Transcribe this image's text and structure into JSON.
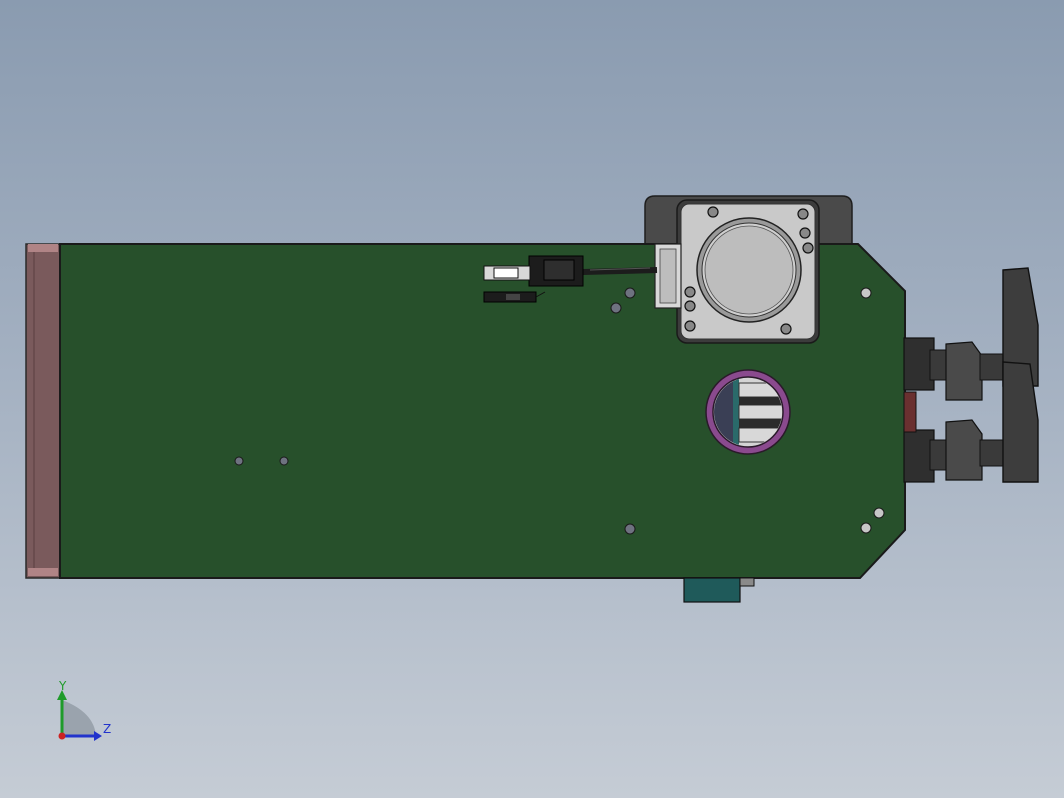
{
  "viewport": {
    "background_top": "#8a9bb0",
    "background_bottom": "#c5ccd5"
  },
  "model": {
    "plate_color": "#27502b",
    "plate_edge_color": "#1a1a1a",
    "end_block_color": "#7a5a5c",
    "motor_bracket_color": "#4a4a4a",
    "motor_face_color": "#c9c9c9",
    "motor_hub_color": "#bfbfbf",
    "ring_color": "#8a4a8e",
    "knob_color": "#3a3a3a",
    "teal_block_color": "#1f5a5a",
    "connector_color": "#1c1c1c"
  },
  "triad": {
    "y_label": "Y",
    "z_label": "Z",
    "y_color": "#1f9b2a",
    "z_color": "#2233cc",
    "x_color": "#cc2222"
  }
}
